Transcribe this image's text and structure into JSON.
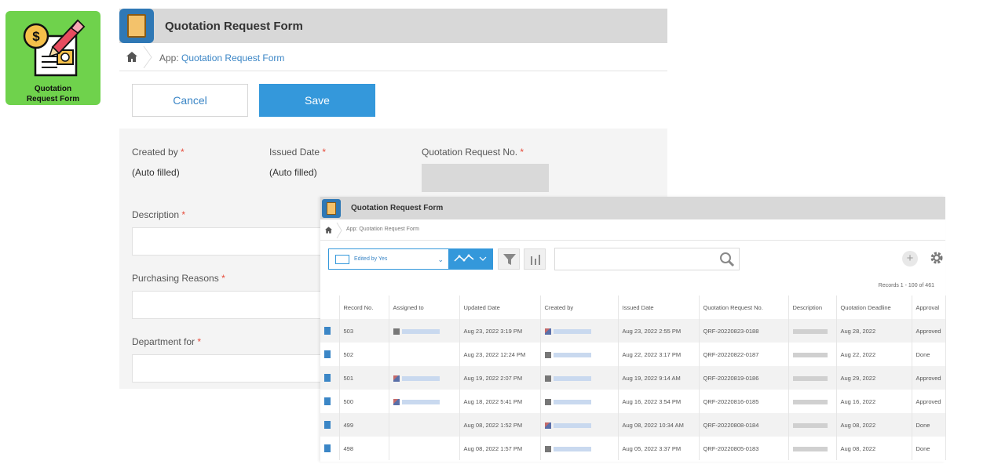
{
  "badge": {
    "line1": "Quotation",
    "line2": "Request Form"
  },
  "form": {
    "title": "Quotation Request Form",
    "breadcrumb_prefix": "App:",
    "breadcrumb_link": "Quotation Request Form",
    "cancel_label": "Cancel",
    "save_label": "Save",
    "fields": {
      "created_by": {
        "label": "Created by",
        "value": "(Auto filled)"
      },
      "issued_date": {
        "label": "Issued Date",
        "value": "(Auto filled)"
      },
      "quotation_no": {
        "label": "Quotation Request No."
      },
      "description": {
        "label": "Description"
      },
      "purchasing_reasons": {
        "label": "Purchasing Reasons"
      },
      "department_for": {
        "label": "Department for"
      }
    },
    "required_mark": "*"
  },
  "list": {
    "title": "Quotation Request Form",
    "breadcrumb": "App: Quotation Request Form",
    "view_label": "Edited by Yes",
    "records_count": "Records 1 - 100 of 461",
    "columns": [
      "Record No.",
      "Assigned to",
      "Updated Date",
      "Created by",
      "Issued Date",
      "Quotation Request No.",
      "Description",
      "Quotation Deadline",
      "Approval"
    ],
    "rows": [
      {
        "record": "503",
        "updated": "Aug 23, 2022 3:19 PM",
        "issued": "Aug 23, 2022 2:55 PM",
        "qr_no": "QRF-20220823-0188",
        "deadline": "Aug 28, 2022",
        "status": "Approved"
      },
      {
        "record": "502",
        "updated": "Aug 23, 2022 12:24 PM",
        "issued": "Aug 22, 2022 3:17 PM",
        "qr_no": "QRF-20220822-0187",
        "deadline": "Aug 22, 2022",
        "status": "Done"
      },
      {
        "record": "501",
        "updated": "Aug 19, 2022 2:07 PM",
        "issued": "Aug 19, 2022 9:14 AM",
        "qr_no": "QRF-20220819-0186",
        "deadline": "Aug 29, 2022",
        "status": "Approved"
      },
      {
        "record": "500",
        "updated": "Aug 18, 2022 5:41 PM",
        "issued": "Aug 16, 2022 3:54 PM",
        "qr_no": "QRF-20220816-0185",
        "deadline": "Aug 16, 2022",
        "status": "Approved"
      },
      {
        "record": "499",
        "updated": "Aug 08, 2022 1:52 PM",
        "issued": "Aug 08, 2022 10:34 AM",
        "qr_no": "QRF-20220808-0184",
        "deadline": "Aug 08, 2022",
        "status": "Done"
      },
      {
        "record": "498",
        "updated": "Aug 08, 2022 1:57 PM",
        "issued": "Aug 05, 2022 3:37 PM",
        "qr_no": "QRF-20220805-0183",
        "deadline": "Aug 08, 2022",
        "status": "Done"
      }
    ]
  },
  "icons": {
    "home": "home-icon",
    "search": "search-icon",
    "filter": "filter-icon",
    "chart": "bar-chart-icon",
    "graph": "line-graph-icon",
    "plus": "plus-icon",
    "gear": "gear-icon"
  },
  "colors": {
    "accent": "#3498db",
    "badge_bg": "#6fd24c",
    "required": "#e74c3c",
    "header_gray": "#d8d8d8"
  }
}
